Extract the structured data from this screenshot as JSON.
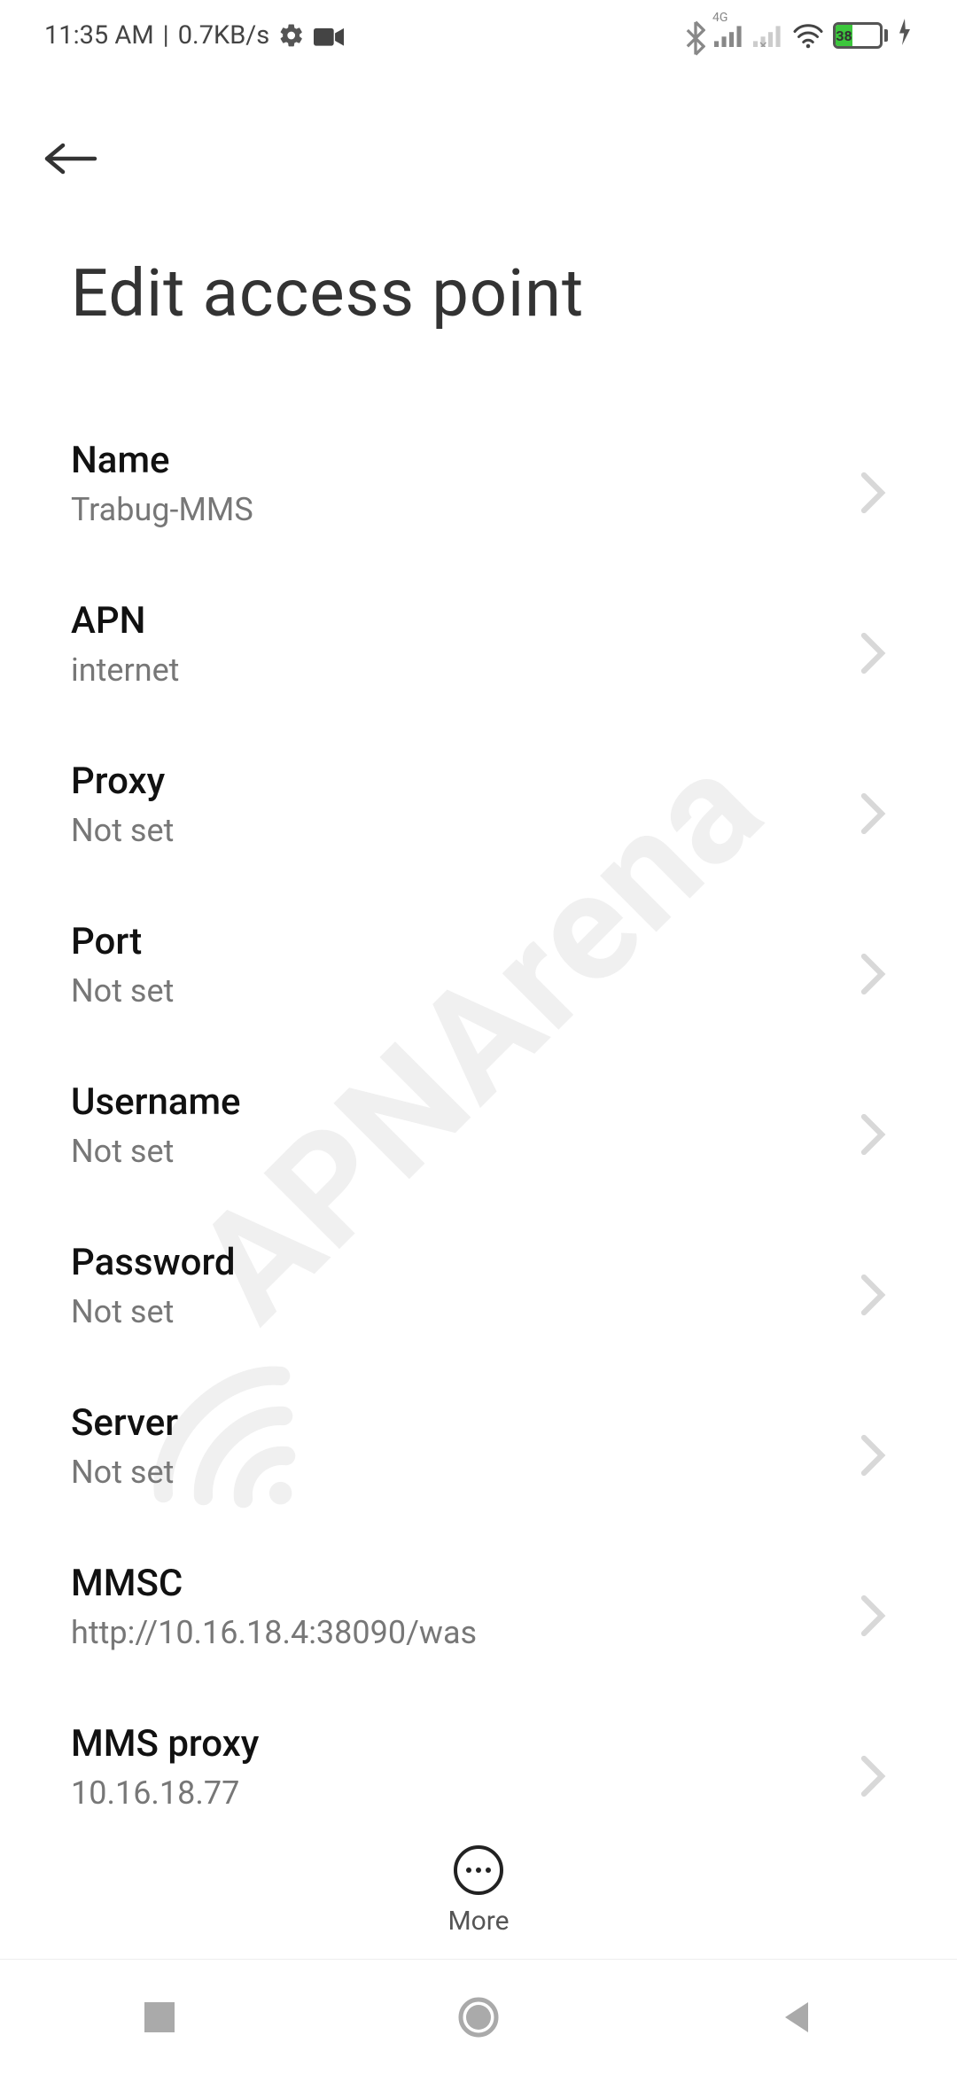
{
  "status_bar": {
    "time": "11:35 AM",
    "separator": "|",
    "data_rate": "0.7KB/s",
    "network_label": "4G",
    "battery_pct": "38"
  },
  "header": {
    "title": "Edit access point"
  },
  "settings": [
    {
      "label": "Name",
      "value": "Trabug-MMS"
    },
    {
      "label": "APN",
      "value": "internet"
    },
    {
      "label": "Proxy",
      "value": "Not set"
    },
    {
      "label": "Port",
      "value": "Not set"
    },
    {
      "label": "Username",
      "value": "Not set"
    },
    {
      "label": "Password",
      "value": "Not set"
    },
    {
      "label": "Server",
      "value": "Not set"
    },
    {
      "label": "MMSC",
      "value": "http://10.16.18.4:38090/was"
    },
    {
      "label": "MMS proxy",
      "value": "10.16.18.77"
    }
  ],
  "footer": {
    "more_label": "More"
  },
  "watermark_text": "APNArena"
}
